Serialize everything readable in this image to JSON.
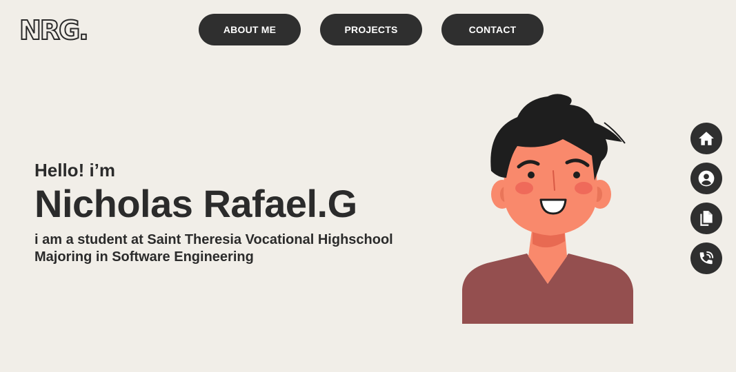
{
  "logo": {
    "text": "NRG."
  },
  "nav": {
    "about": "ABOUT ME",
    "projects": "PROJECTS",
    "contact": "CONTACT"
  },
  "hero": {
    "greeting": "Hello! i’m",
    "name": "Nicholas Rafael.G",
    "bio_line_1": "i am a student at Saint Theresia Vocational Highschool",
    "bio_line_2": "Majoring in Software Engineering"
  },
  "side_icons": [
    "home-icon",
    "profile-icon",
    "documents-icon",
    "phone-icon"
  ],
  "colors": {
    "background": "#f1eee8",
    "dark": "#2f2f2f",
    "skin": "#f9896c",
    "shirt": "#944f4f",
    "hair": "#1e1e1e"
  }
}
